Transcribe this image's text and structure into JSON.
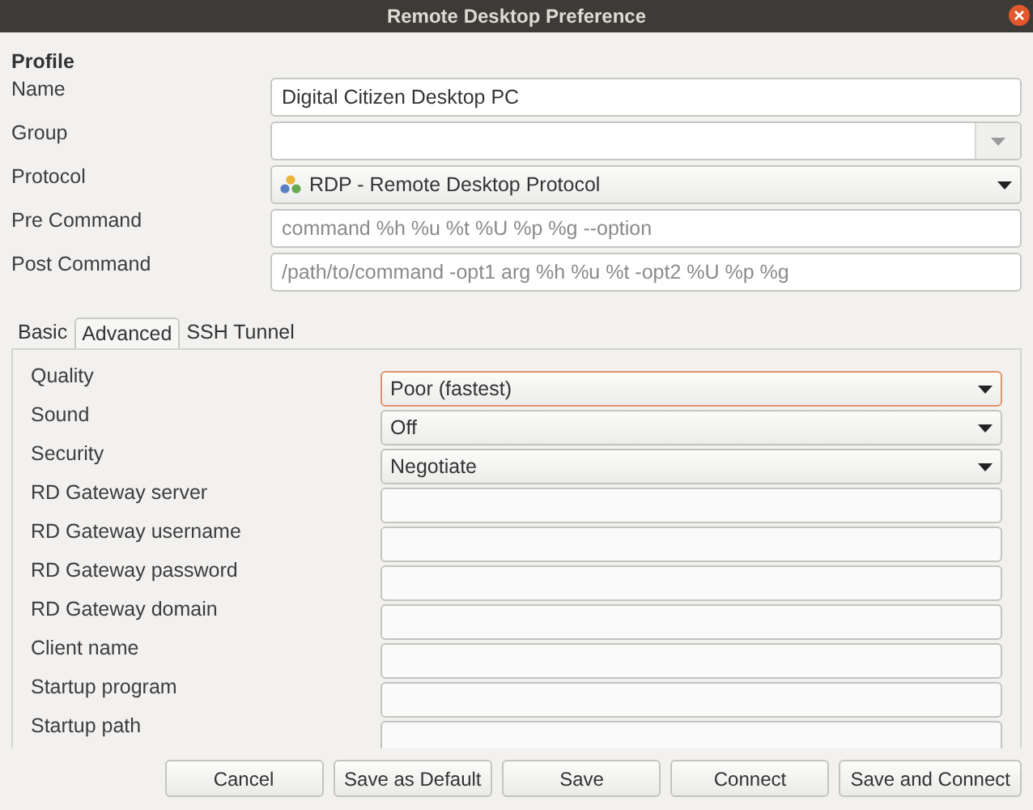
{
  "window": {
    "title": "Remote Desktop Preference"
  },
  "profile": {
    "heading": "Profile",
    "fields": [
      {
        "label": "Name",
        "kind": "entry",
        "value": "Digital Citizen Desktop PC"
      },
      {
        "label": "Group",
        "kind": "combo-entry"
      },
      {
        "label": "Protocol",
        "kind": "combo",
        "value": "RDP - Remote Desktop Protocol",
        "icon": true
      },
      {
        "label": "Pre Command",
        "kind": "entry",
        "placeholder": "command %h %u %t %U %p %g --option"
      },
      {
        "label": "Post Command",
        "kind": "entry",
        "placeholder": "/path/to/command -opt1 arg %h %u %t -opt2 %U %p %g"
      }
    ]
  },
  "tabs": [
    {
      "label": "Basic",
      "selected": false
    },
    {
      "label": "Advanced",
      "selected": true
    },
    {
      "label": "SSH Tunnel",
      "selected": false
    }
  ],
  "advanced": [
    {
      "label": "Quality",
      "kind": "combo",
      "value": "Poor (fastest)",
      "focused": true
    },
    {
      "label": "Sound",
      "kind": "combo",
      "value": "Off",
      "focused": false
    },
    {
      "label": "Security",
      "kind": "combo",
      "value": "Negotiate",
      "focused": false
    },
    {
      "label": "RD Gateway server",
      "kind": "entry",
      "focused": false
    },
    {
      "label": "RD Gateway username",
      "kind": "entry",
      "focused": false
    },
    {
      "label": "RD Gateway password",
      "kind": "entry",
      "focused": false
    },
    {
      "label": "RD Gateway domain",
      "kind": "entry",
      "focused": false
    },
    {
      "label": "Client name",
      "kind": "entry",
      "focused": false
    },
    {
      "label": "Startup program",
      "kind": "entry",
      "focused": false
    },
    {
      "label": "Startup path",
      "kind": "entry",
      "focused": false
    }
  ],
  "buttons": [
    "Cancel",
    "Save as Default",
    "Save",
    "Connect",
    "Save and Connect"
  ]
}
